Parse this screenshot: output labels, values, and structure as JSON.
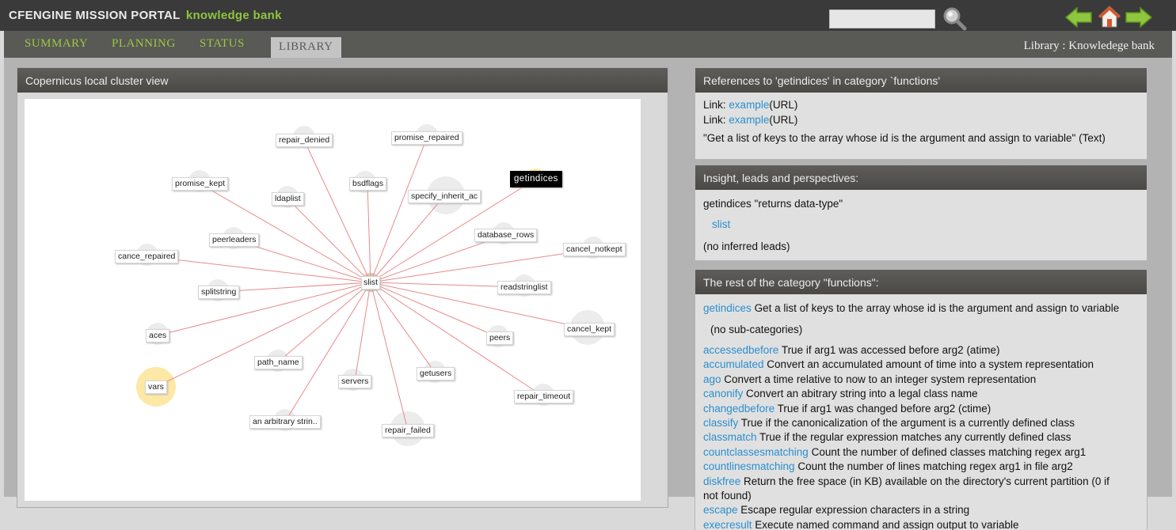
{
  "header": {
    "brand": "CFENGINE MISSION PORTAL",
    "brand_sub": "knowledge bank",
    "search_value": ""
  },
  "tabs": [
    "SUMMARY",
    "PLANNING",
    "STATUS",
    "LIBRARY"
  ],
  "active_tab": "LIBRARY",
  "breadcrumb": "Library : Knowledege bank",
  "cluster": {
    "title": "Copernicus local cluster view",
    "center": "slist",
    "selected": "getindices",
    "nodes": [
      "repair_denied",
      "promise_repaired",
      "getindices",
      "promise_kept",
      "ldaplist",
      "bsdflags",
      "specify_inherit_ac",
      "peerleaders",
      "database_rows",
      "cancel_notkept",
      "cance_repaired",
      "readstringlist",
      "splitstring",
      "aces",
      "cancel_kept",
      "peers",
      "path_name",
      "getusers",
      "servers",
      "vars",
      "repair_timeout",
      "an arbitrary strin..",
      "repair_failed"
    ]
  },
  "references": {
    "title": "References to 'getindices' in category `functions'",
    "links": [
      {
        "prefix": "Link:",
        "text": "example",
        "suffix": "(URL)"
      },
      {
        "prefix": "Link:",
        "text": "example",
        "suffix": "(URL)"
      }
    ],
    "quote": "\"Get a list of keys to the array whose id is the argument and assign to variable\" (Text)"
  },
  "insight": {
    "title": "Insight, leads and perspectives:",
    "relation": "getindices \"returns data-type\"",
    "related_link": "slist",
    "note": "(no inferred leads)"
  },
  "category": {
    "title": "The rest of the category \"functions\":",
    "current_name": "getindices",
    "current_desc": "Get a list of keys to the array whose id is the argument and assign to variable",
    "subcats": "(no sub-categories)",
    "functions": [
      {
        "name": "accessedbefore",
        "desc": "True if arg1 was accessed before arg2 (atime)"
      },
      {
        "name": "accumulated",
        "desc": "Convert an accumulated amount of time into a system representation"
      },
      {
        "name": "ago",
        "desc": "Convert a time relative to now to an integer system representation"
      },
      {
        "name": "canonify",
        "desc": "Convert an abitrary string into a legal class name"
      },
      {
        "name": "changedbefore",
        "desc": "True if arg1 was changed before arg2 (ctime)"
      },
      {
        "name": "classify",
        "desc": "True if the canonicalization of the argument is a currently defined class"
      },
      {
        "name": "classmatch",
        "desc": "True if the regular expression matches any currently defined class"
      },
      {
        "name": "countclassesmatching",
        "desc": "Count the number of defined classes matching regex arg1"
      },
      {
        "name": "countlinesmatching",
        "desc": "Count the number of lines matching regex arg1 in file arg2"
      },
      {
        "name": "diskfree",
        "desc": "Return the free space (in KB) available on the directory's current partition (0 if",
        "desc2": "not found)"
      },
      {
        "name": "escape",
        "desc": "Escape regular expression characters in a string"
      },
      {
        "name": "execresult",
        "desc": "Execute named command and assign output to variable"
      }
    ]
  },
  "colors": {
    "brand_green": "#8fc63f",
    "link_blue": "#2a8fcf",
    "edge_red": "#e88a8a",
    "header_dark": "#3a3a3a"
  }
}
